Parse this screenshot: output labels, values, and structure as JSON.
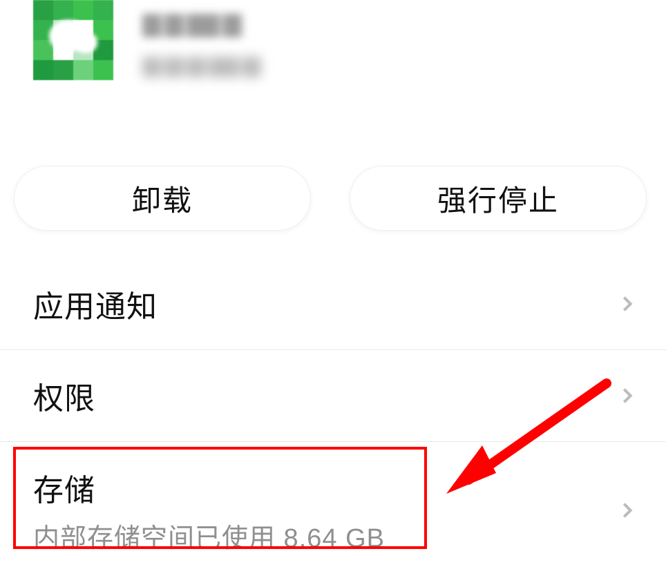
{
  "app": {
    "icon_semantic": "wechat-icon",
    "name_obscured": true,
    "version_obscured": true
  },
  "buttons": {
    "uninstall": "卸载",
    "force_stop": "强行停止"
  },
  "rows": {
    "notifications": {
      "title": "应用通知"
    },
    "permissions": {
      "title": "权限"
    },
    "storage": {
      "title": "存储",
      "subtitle": "内部存储空间已使用 8.64 GB"
    }
  },
  "annotation": {
    "highlight_target": "storage-row",
    "arrow_color": "#ff0000"
  }
}
